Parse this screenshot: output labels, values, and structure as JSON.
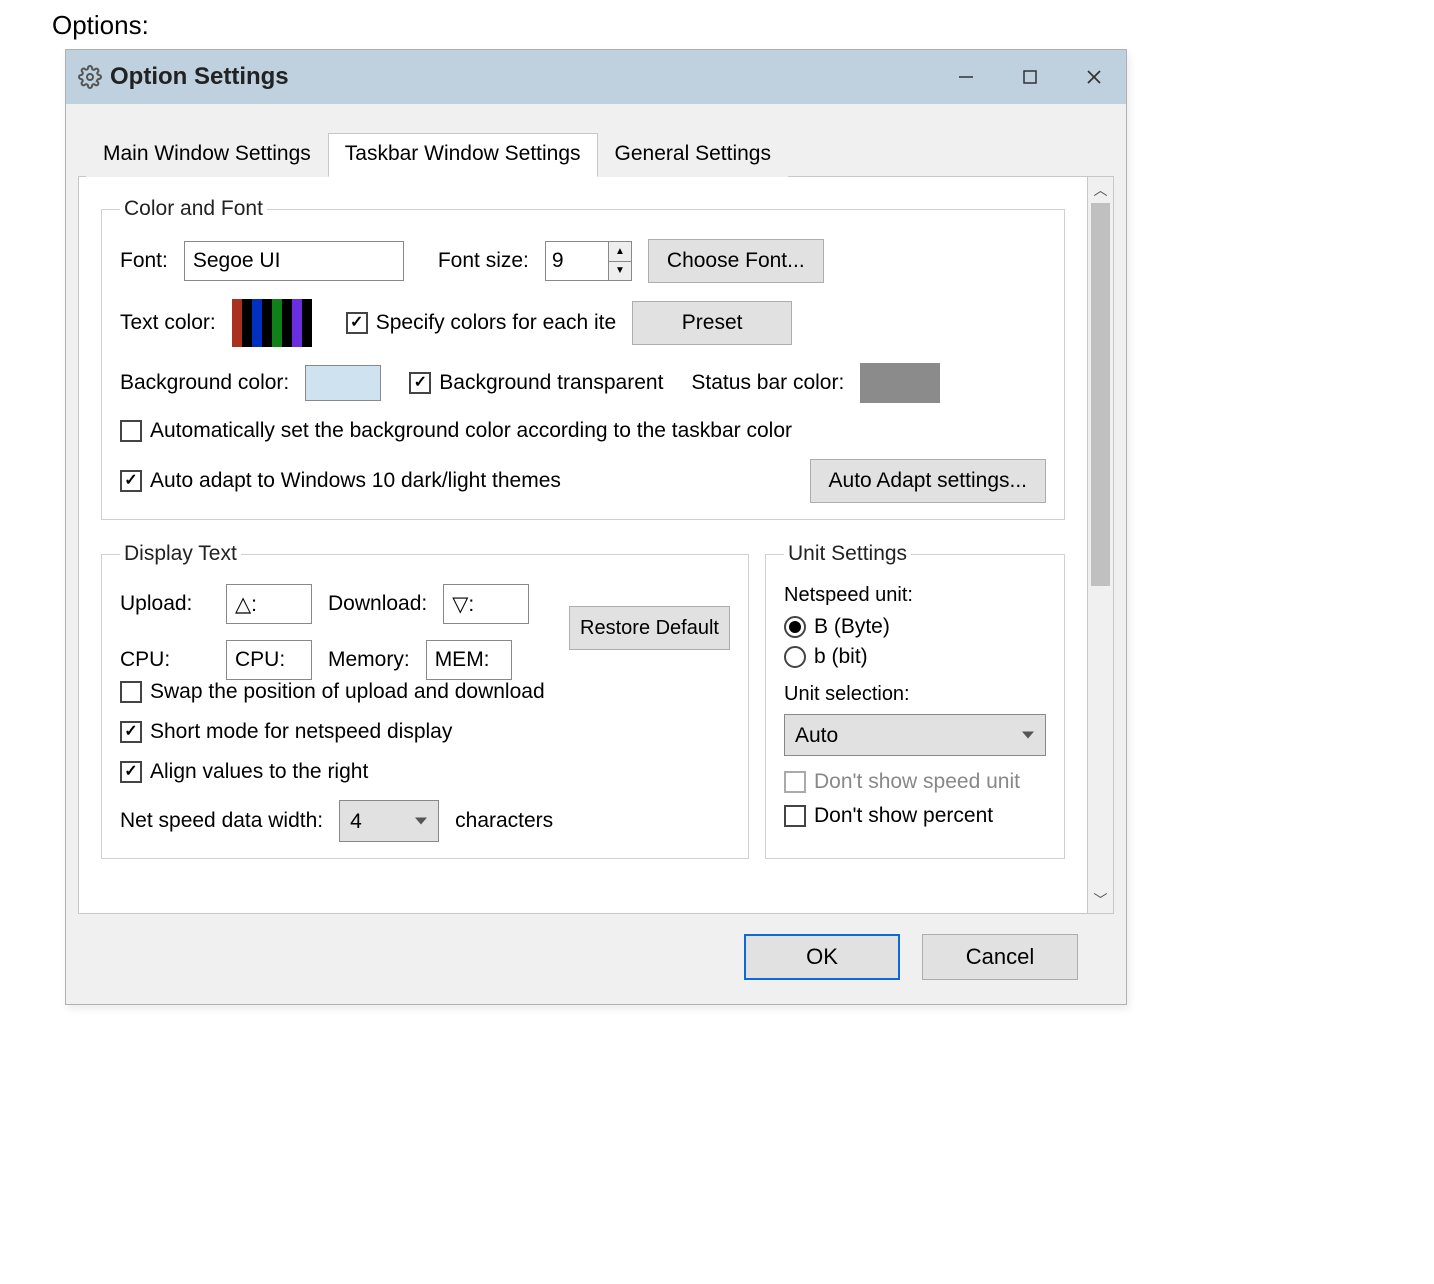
{
  "outer_label": "Options:",
  "window": {
    "title": "Option Settings"
  },
  "tabs": {
    "items": [
      {
        "label": "Main Window Settings",
        "active": false
      },
      {
        "label": "Taskbar Window Settings",
        "active": true
      },
      {
        "label": "General Settings",
        "active": false
      }
    ]
  },
  "color_font": {
    "legend": "Color and Font",
    "font_label": "Font:",
    "font_value": "Segoe UI",
    "font_size_label": "Font size:",
    "font_size_value": "9",
    "choose_font_btn": "Choose Font...",
    "text_color_label": "Text color:",
    "text_color_swatches": [
      "#aa3020",
      "#000000",
      "#0030c0",
      "#000000",
      "#108018",
      "#000000",
      "#6a2ee0",
      "#000000"
    ],
    "specify_each_checked": true,
    "specify_each_label": "Specify colors for each ite",
    "preset_btn": "Preset",
    "bg_color_label": "Background color:",
    "bg_color_value": "#cfe2ef",
    "bg_transparent_checked": true,
    "bg_transparent_label": "Background transparent",
    "statusbar_label": "Status bar color:",
    "statusbar_color": "#8b8b8b",
    "auto_bg_checked": false,
    "auto_bg_label": "Automatically set the background color according to the taskbar color",
    "auto_adapt_checked": true,
    "auto_adapt_label": "Auto adapt to Windows 10 dark/light themes",
    "auto_adapt_btn": "Auto Adapt settings..."
  },
  "display_text": {
    "legend": "Display Text",
    "upload_label": "Upload:",
    "upload_value": "△:",
    "download_label": "Download:",
    "download_value": "▽:",
    "cpu_label": "CPU:",
    "cpu_value": "CPU:",
    "memory_label": "Memory:",
    "memory_value": "MEM:",
    "restore_btn": "Restore Default",
    "swap_checked": false,
    "swap_label": "Swap the position of upload and download",
    "short_checked": true,
    "short_label": "Short mode for netspeed display",
    "align_checked": true,
    "align_label": "Align values to the right",
    "width_label": "Net speed data width:",
    "width_value": "4",
    "width_suffix": "characters"
  },
  "unit_settings": {
    "legend": "Unit Settings",
    "netspeed_unit_label": "Netspeed unit:",
    "radio_byte": "B (Byte)",
    "radio_bit": "b (bit)",
    "radio_selected": "byte",
    "unit_selection_label": "Unit selection:",
    "unit_selection_value": "Auto",
    "dont_show_speed_unit_label": "Don't show speed unit",
    "dont_show_speed_unit_disabled": true,
    "dont_show_percent_checked": false,
    "dont_show_percent_label": "Don't show percent"
  },
  "footer": {
    "ok": "OK",
    "cancel": "Cancel"
  }
}
